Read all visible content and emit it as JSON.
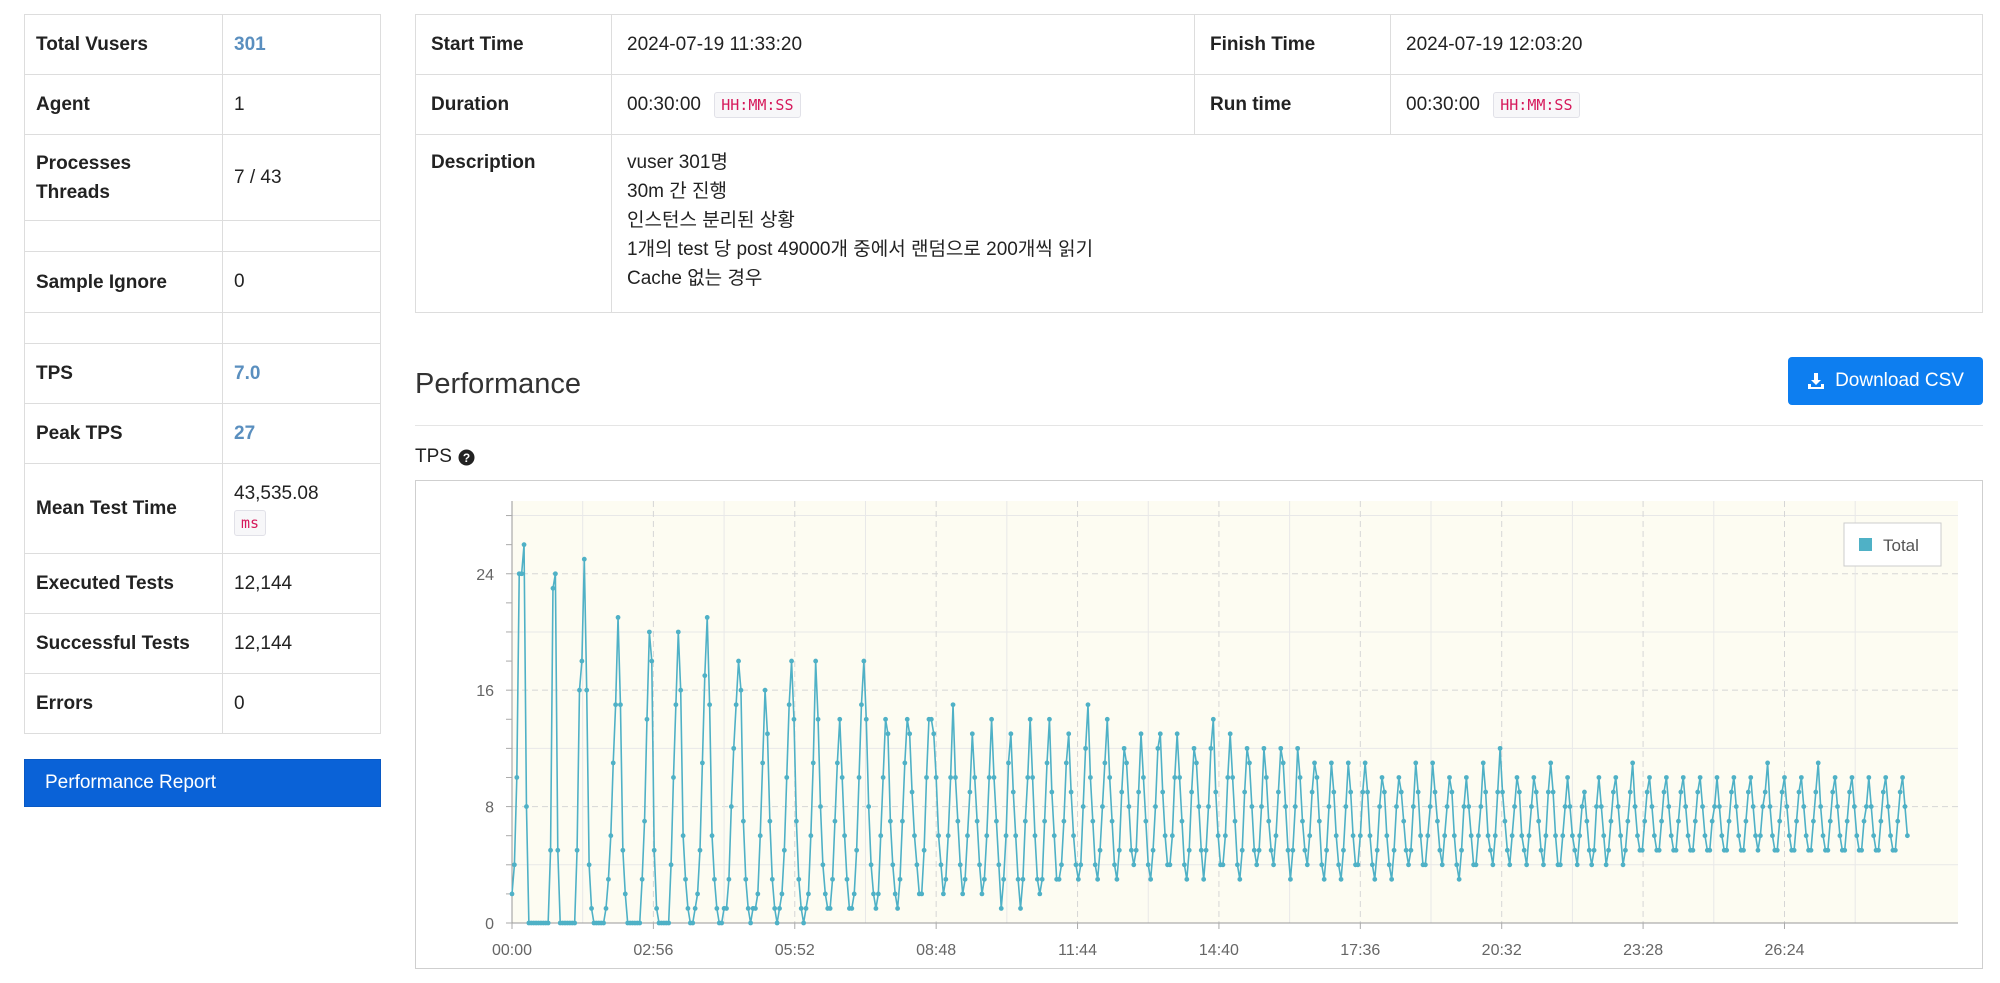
{
  "summary": {
    "total_vusers_label": "Total Vusers",
    "total_vusers": "301",
    "agent_label": "Agent",
    "agent": "1",
    "processes_label": "Processes",
    "threads_label": "Threads",
    "processes_threads": "7 / 43",
    "sample_ignore_label": "Sample Ignore",
    "sample_ignore": "0",
    "tps_label": "TPS",
    "tps": "7.0",
    "peak_tps_label": "Peak TPS",
    "peak_tps": "27",
    "mean_test_time_label": "Mean Test Time",
    "mean_test_time": "43,535.08",
    "mean_test_time_unit": "ms",
    "executed_tests_label": "Executed Tests",
    "executed_tests": "12,144",
    "successful_tests_label": "Successful Tests",
    "successful_tests": "12,144",
    "errors_label": "Errors",
    "errors": "0",
    "report_button": "Performance Report"
  },
  "info": {
    "start_time_label": "Start Time",
    "start_time": "2024-07-19 11:33:20",
    "finish_time_label": "Finish Time",
    "finish_time": "2024-07-19 12:03:20",
    "duration_label": "Duration",
    "duration": "00:30:00",
    "duration_format": "HH:MM:SS",
    "run_time_label": "Run time",
    "run_time": "00:30:00",
    "run_time_format": "HH:MM:SS",
    "description_label": "Description",
    "description_lines": [
      "vuser 301명",
      "30m 간 진행",
      "인스턴스 분리된 상황",
      "1개의 test 당 post 49000개 중에서 랜덤으로 200개씩 읽기",
      "Cache 없는 경우"
    ]
  },
  "performance": {
    "title": "Performance",
    "download_button": "Download CSV",
    "tps_chart_label": "TPS",
    "help_icon": "question-circle-icon",
    "download_icon": "download-icon"
  },
  "colors": {
    "accent_link": "#5a8fbf",
    "primary_button": "#0a62d7",
    "download_button": "#0d7ef0",
    "series": "#4fb1c6",
    "plot_background": "#fdfcf2",
    "code_text": "#d6195b"
  },
  "chart_data": {
    "type": "line",
    "ylabel": "",
    "xlabel": "",
    "y_ticks": [
      0,
      8,
      16,
      24
    ],
    "ylim": [
      0,
      29
    ],
    "x_ticks": [
      "00:00",
      "02:56",
      "05:52",
      "08:48",
      "11:44",
      "14:40",
      "17:36",
      "20:32",
      "23:28",
      "26:24"
    ],
    "x_tick_seconds": [
      0,
      176,
      352,
      528,
      704,
      880,
      1056,
      1232,
      1408,
      1584
    ],
    "xlim_seconds": [
      0,
      1800
    ],
    "grid": true,
    "legend_position": "top-right",
    "series": [
      {
        "name": "Total",
        "x_step_seconds": 3,
        "values": [
          2,
          4,
          10,
          24,
          24,
          26,
          8,
          0,
          0,
          0,
          0,
          0,
          0,
          0,
          0,
          0,
          5,
          23,
          24,
          5,
          0,
          0,
          0,
          0,
          0,
          0,
          0,
          5,
          16,
          18,
          25,
          16,
          4,
          1,
          0,
          0,
          0,
          0,
          0,
          1,
          3,
          6,
          11,
          15,
          21,
          15,
          5,
          2,
          0,
          0,
          0,
          0,
          0,
          0,
          3,
          7,
          14,
          20,
          18,
          5,
          1,
          0,
          0,
          0,
          0,
          0,
          4,
          10,
          15,
          20,
          16,
          6,
          3,
          1,
          0,
          0,
          1,
          2,
          5,
          11,
          17,
          21,
          15,
          6,
          3,
          1,
          0,
          0,
          1,
          1,
          3,
          8,
          12,
          15,
          18,
          16,
          7,
          3,
          1,
          0,
          1,
          1,
          2,
          6,
          11,
          16,
          13,
          7,
          3,
          1,
          0,
          1,
          2,
          5,
          10,
          15,
          18,
          14,
          7,
          3,
          1,
          0,
          1,
          2,
          6,
          11,
          18,
          14,
          8,
          4,
          2,
          1,
          1,
          3,
          7,
          11,
          14,
          10,
          6,
          3,
          1,
          1,
          2,
          5,
          10,
          15,
          18,
          14,
          8,
          4,
          2,
          1,
          2,
          6,
          10,
          14,
          13,
          7,
          4,
          2,
          1,
          3,
          7,
          11,
          14,
          13,
          9,
          6,
          4,
          2,
          2,
          5,
          10,
          14,
          14,
          13,
          10,
          6,
          4,
          2,
          3,
          6,
          10,
          15,
          10,
          7,
          4,
          2,
          3,
          6,
          9,
          13,
          10,
          7,
          4,
          2,
          3,
          6,
          10,
          14,
          10,
          7,
          4,
          1,
          3,
          6,
          11,
          13,
          9,
          6,
          3,
          1,
          3,
          7,
          10,
          14,
          10,
          6,
          3,
          2,
          3,
          7,
          11,
          14,
          9,
          6,
          3,
          3,
          4,
          7,
          11,
          13,
          9,
          6,
          4,
          3,
          4,
          8,
          12,
          15,
          10,
          7,
          4,
          3,
          5,
          8,
          11,
          14,
          10,
          7,
          4,
          3,
          5,
          9,
          12,
          11,
          8,
          5,
          4,
          5,
          9,
          13,
          10,
          7,
          4,
          3,
          5,
          8,
          12,
          13,
          9,
          6,
          4,
          4,
          6,
          10,
          13,
          10,
          7,
          4,
          3,
          5,
          9,
          12,
          11,
          8,
          5,
          3,
          5,
          8,
          12,
          14,
          9,
          6,
          4,
          4,
          6,
          10,
          13,
          10,
          7,
          4,
          3,
          5,
          9,
          12,
          11,
          8,
          5,
          4,
          5,
          8,
          12,
          10,
          7,
          5,
          4,
          6,
          9,
          12,
          11,
          8,
          5,
          3,
          5,
          8,
          12,
          10,
          7,
          5,
          4,
          6,
          9,
          11,
          10,
          7,
          4,
          3,
          5,
          8,
          11,
          9,
          6,
          4,
          3,
          5,
          8,
          11,
          9,
          6,
          4,
          4,
          6,
          9,
          11,
          9,
          6,
          4,
          3,
          5,
          8,
          10,
          9,
          6,
          4,
          3,
          5,
          8,
          10,
          9,
          7,
          5,
          4,
          5,
          8,
          11,
          9,
          6,
          4,
          4,
          6,
          8,
          11,
          9,
          7,
          5,
          4,
          6,
          8,
          10,
          9,
          6,
          4,
          3,
          5,
          8,
          10,
          8,
          6,
          4,
          4,
          6,
          8,
          11,
          9,
          6,
          5,
          4,
          6,
          9,
          12,
          9,
          7,
          5,
          4,
          6,
          8,
          10,
          9,
          6,
          5,
          4,
          6,
          8,
          10,
          9,
          7,
          5,
          4,
          6,
          9,
          11,
          9,
          6,
          4,
          4,
          6,
          8,
          10,
          8,
          6,
          5,
          4,
          6,
          8,
          9,
          7,
          5,
          4,
          5,
          8,
          10,
          8,
          6,
          4,
          5,
          7,
          9,
          10,
          8,
          6,
          4,
          5,
          7,
          9,
          11,
          8,
          6,
          5,
          5,
          7,
          9,
          10,
          8,
          6,
          5,
          5,
          7,
          9,
          10,
          8,
          6,
          5,
          5,
          7,
          9,
          10,
          8,
          6,
          5,
          5,
          7,
          9,
          10,
          8,
          6,
          5,
          5,
          7,
          8,
          10,
          8,
          6,
          5,
          5,
          7,
          9,
          10,
          8,
          6,
          5,
          5,
          7,
          9,
          10,
          8,
          6,
          5,
          6,
          8,
          9,
          11,
          8,
          6,
          5,
          5,
          7,
          9,
          10,
          8,
          6,
          5,
          5,
          7,
          9,
          10,
          8,
          6,
          5,
          5,
          7,
          9,
          11,
          8,
          6,
          5,
          5,
          7,
          9,
          10,
          8,
          6,
          5,
          5,
          7,
          9,
          10,
          8,
          6,
          5,
          5,
          7,
          8,
          10,
          8,
          6,
          5,
          5,
          7,
          9,
          10,
          8,
          6,
          5,
          5,
          7,
          9,
          10,
          8,
          6
        ]
      }
    ]
  }
}
